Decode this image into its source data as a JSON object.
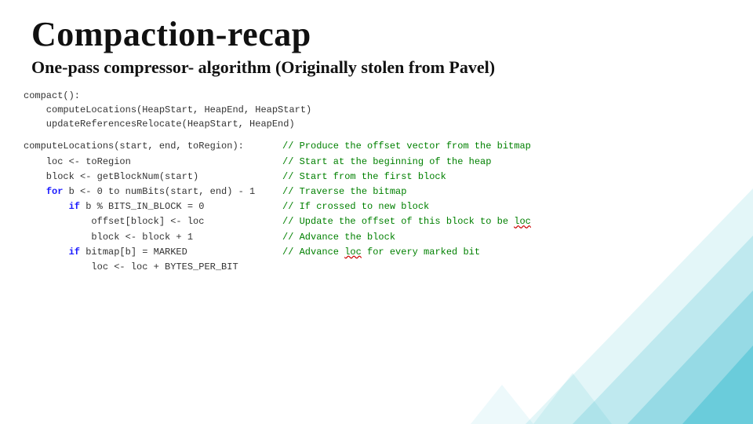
{
  "title": "Compaction-recap",
  "subtitle": "One-pass compressor- algorithm (Originally stolen from Pavel)",
  "block1": {
    "lines": [
      "compact():",
      "    computeLocations(HeapStart, HeapEnd, HeapStart)",
      "    updateReferencesRelocate(HeapStart, HeapEnd)"
    ]
  },
  "block2": {
    "rows": [
      {
        "code_html": "computeLocations(start, end, toRegion):",
        "comment": "// Produce the offset vector from the bitmap"
      },
      {
        "code_html": "    loc <- toRegion",
        "comment": "// Start at the beginning of the heap"
      },
      {
        "code_html": "    block <- getBlockNum(start)",
        "comment": "// Start from the first block"
      },
      {
        "code_html": "    <span class=\"kw\">for</span> b <- 0 to numBits(start, end) - 1",
        "comment": "// Traverse the bitmap"
      },
      {
        "code_html": "        <span class=\"kw\">if</span> b % BITS_IN_BLOCK = 0",
        "comment": "// If crossed to new block"
      },
      {
        "code_html": "            offset[block] <- loc",
        "comment_html": "// Update the offset of this block to be <span class=\"red-wavy\">loc</span>"
      },
      {
        "code_html": "            block <- block + 1",
        "comment": "// Advance the block"
      },
      {
        "code_html": "        <span class=\"kw\">if</span> bitmap[b] = MARKED",
        "comment_html": "// Advance <span class=\"red-wavy\">loc</span> for every marked bit"
      },
      {
        "code_html": "            loc <- loc + BYTES_PER_BIT",
        "comment": ""
      }
    ]
  }
}
